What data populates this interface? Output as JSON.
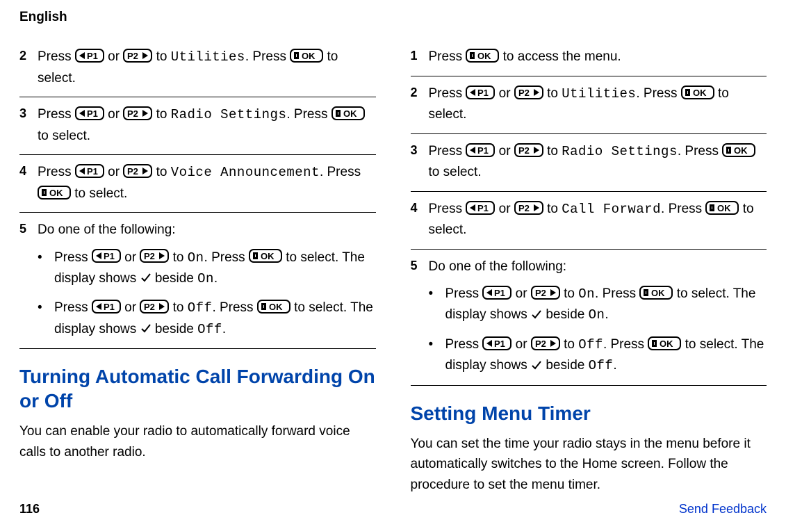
{
  "header": "English",
  "left": {
    "step2": {
      "num": "2",
      "t1": "Press ",
      "t2": " or ",
      "t3": " to ",
      "code1": "Utilities",
      "t4": ". Press ",
      "t5": " to select."
    },
    "step3": {
      "num": "3",
      "t1": "Press ",
      "t2": " or ",
      "t3": " to ",
      "code1": "Radio Settings",
      "t4": ". Press ",
      "t5": " to select."
    },
    "step4": {
      "num": "4",
      "t1": "Press ",
      "t2": " or ",
      "t3": " to ",
      "code1": "Voice Announcement",
      "t4": ". Press ",
      "t5": " to select."
    },
    "step5": {
      "num": "5",
      "lead": "Do one of the following:",
      "b1": {
        "t1": "Press ",
        "t2": " or ",
        "t3": " to ",
        "code1": "On",
        "t4": ". Press ",
        "t5": " to select. The display shows ",
        "t6": " beside ",
        "code2": "On",
        "t7": "."
      },
      "b2": {
        "t1": "Press ",
        "t2": " or ",
        "t3": " to ",
        "code1": "Off",
        "t4": ". Press ",
        "t5": " to select. The display shows ",
        "t6": " beside ",
        "code2": "Off",
        "t7": "."
      }
    },
    "h2": "Turning Automatic Call Forwarding On or Off",
    "intro": "You can enable your radio to automatically forward voice calls to another radio."
  },
  "right": {
    "step1": {
      "num": "1",
      "t1": "Press ",
      "t2": " to access the menu."
    },
    "step2": {
      "num": "2",
      "t1": "Press ",
      "t2": " or ",
      "t3": " to ",
      "code1": "Utilities",
      "t4": ". Press ",
      "t5": " to select."
    },
    "step3": {
      "num": "3",
      "t1": "Press ",
      "t2": " or ",
      "t3": " to ",
      "code1": "Radio Settings",
      "t4": ". Press ",
      "t5": " to select."
    },
    "step4": {
      "num": "4",
      "t1": "Press ",
      "t2": " or ",
      "t3": " to ",
      "code1": "Call Forward",
      "t4": ". Press ",
      "t5": " to select."
    },
    "step5": {
      "num": "5",
      "lead": "Do one of the following:",
      "b1": {
        "t1": "Press ",
        "t2": " or ",
        "t3": " to ",
        "code1": "On",
        "t4": ". Press ",
        "t5": " to select. The display shows ",
        "t6": " beside ",
        "code2": "On",
        "t7": "."
      },
      "b2": {
        "t1": "Press ",
        "t2": " or ",
        "t3": " to ",
        "code1": "Off",
        "t4": ". Press ",
        "t5": " to select. The display shows ",
        "t6": " beside ",
        "code2": "Off",
        "t7": "."
      }
    },
    "h2": "Setting Menu Timer",
    "intro": "You can set the time your radio stays in the menu before it automatically switches to the Home screen. Follow the procedure to set the menu timer."
  },
  "footer": {
    "page": "116",
    "feedback": "Send Feedback"
  }
}
